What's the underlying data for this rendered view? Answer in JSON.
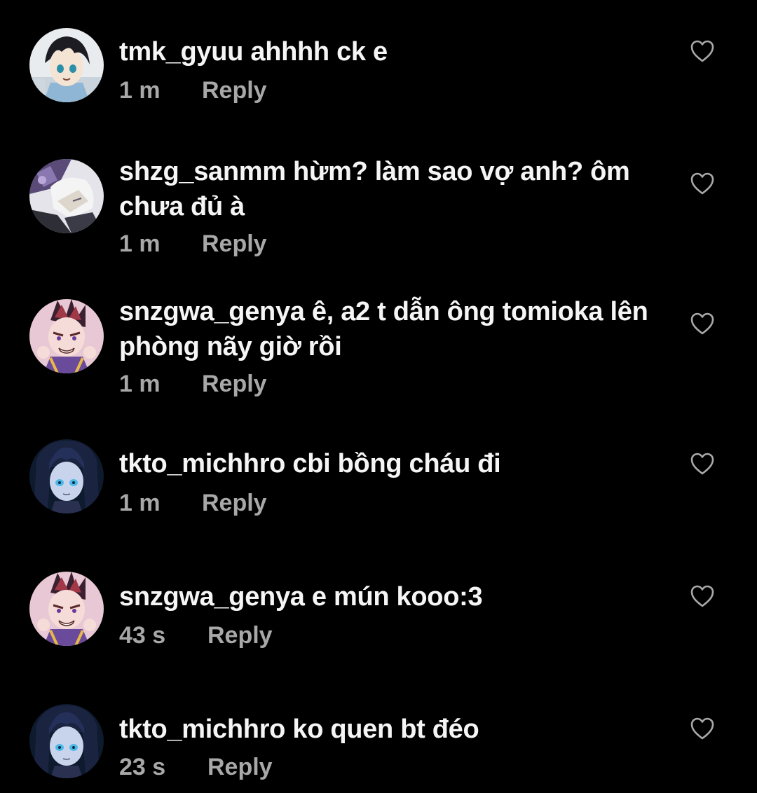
{
  "comments": [
    {
      "username": "tmk_gyuu",
      "text": "ahhhh ck e",
      "time": "1 m",
      "reply_label": "Reply",
      "avatar_icon": "anime-boy-avatar"
    },
    {
      "username": "shzg_sanmm",
      "text": "hừm? làm sao vợ anh? ôm chưa đủ à",
      "time": "1 m",
      "reply_label": "Reply",
      "avatar_icon": "anime-white-hair-avatar"
    },
    {
      "username": "snzgwa_genya",
      "text": "ê, a2 t dẫn ông tomioka lên phòng nãy giờ rồi",
      "time": "1 m",
      "reply_label": "Reply",
      "avatar_icon": "anime-mohawk-avatar"
    },
    {
      "username": "tkto_michhro",
      "text": "cbi bồng cháu đi",
      "time": "1 m",
      "reply_label": "Reply",
      "avatar_icon": "anime-long-hair-avatar"
    },
    {
      "username": "snzgwa_genya",
      "text": "e mún kooo:3",
      "time": "43 s",
      "reply_label": "Reply",
      "avatar_icon": "anime-mohawk-avatar"
    },
    {
      "username": "tkto_michhro",
      "text": "ko quen bt đéo",
      "time": "23 s",
      "reply_label": "Reply",
      "avatar_icon": "anime-long-hair-avatar"
    }
  ],
  "colors": {
    "background": "#000000",
    "primary_text": "#f5f5f5",
    "secondary_text": "#a8a8a8",
    "like_icon": "#a8a8a8"
  }
}
